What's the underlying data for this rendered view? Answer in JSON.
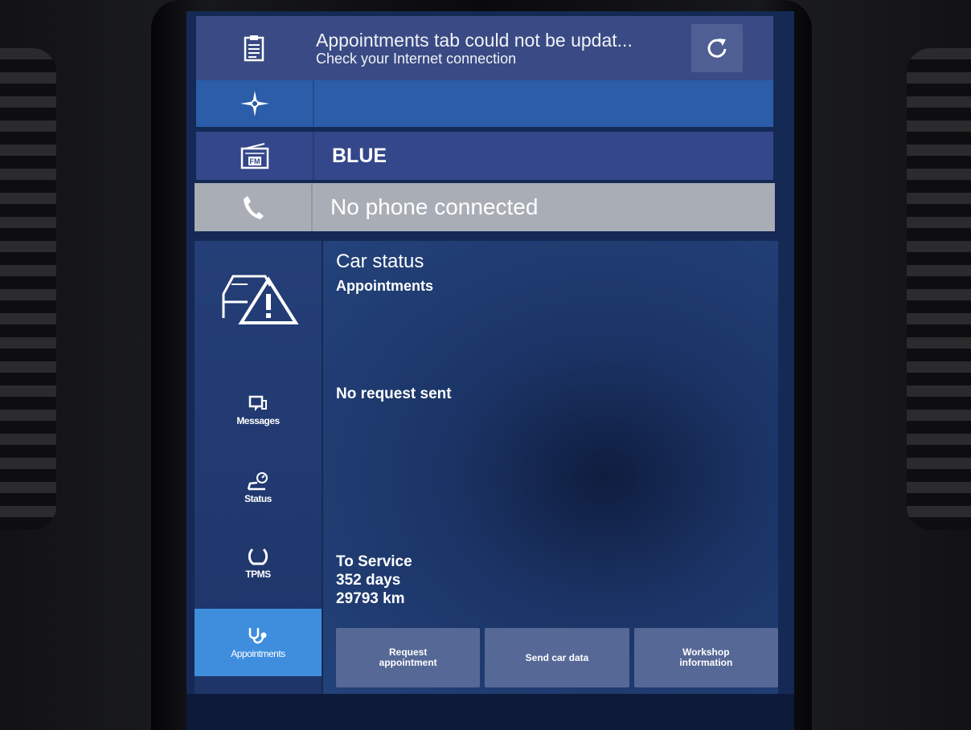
{
  "notification": {
    "title": "Appointments tab could not be updat...",
    "subtitle": "Check your Internet connection",
    "icon": "document-icon",
    "retry_icon": "refresh-icon"
  },
  "navigation": {
    "icon": "compass-icon",
    "text": ""
  },
  "media": {
    "icon": "fm-radio-icon",
    "label": "BLUE"
  },
  "phone": {
    "icon": "phone-icon",
    "label": "No phone connected"
  },
  "sidebar": {
    "app_icon": "car-warning-icon",
    "items": [
      {
        "label": "Messages",
        "icon": "message-icon",
        "active": false
      },
      {
        "label": "Status",
        "icon": "car-status-icon",
        "active": false
      },
      {
        "label": "TPMS",
        "icon": "tire-icon",
        "active": false
      },
      {
        "label": "Appointments",
        "icon": "stethoscope-icon",
        "active": true
      }
    ]
  },
  "main": {
    "title": "Car status",
    "subtitle": "Appointments",
    "status_text": "No request sent",
    "service": {
      "label": "To Service",
      "days": "352 days",
      "distance": "29793 km"
    },
    "buttons": [
      {
        "line1": "Request",
        "line2": "appointment"
      },
      {
        "line1": "Send car data",
        "line2": ""
      },
      {
        "line1": "Workshop",
        "line2": "information"
      }
    ]
  },
  "colors": {
    "screen_bg": "#142a55",
    "notification_bg": "#3a4a84",
    "nav_bar": "#2b5da9",
    "radio_bar": "#34478a",
    "phone_bar": "#a9aeb6",
    "active_tab": "#3f8ede",
    "button_bg": "#566896"
  }
}
